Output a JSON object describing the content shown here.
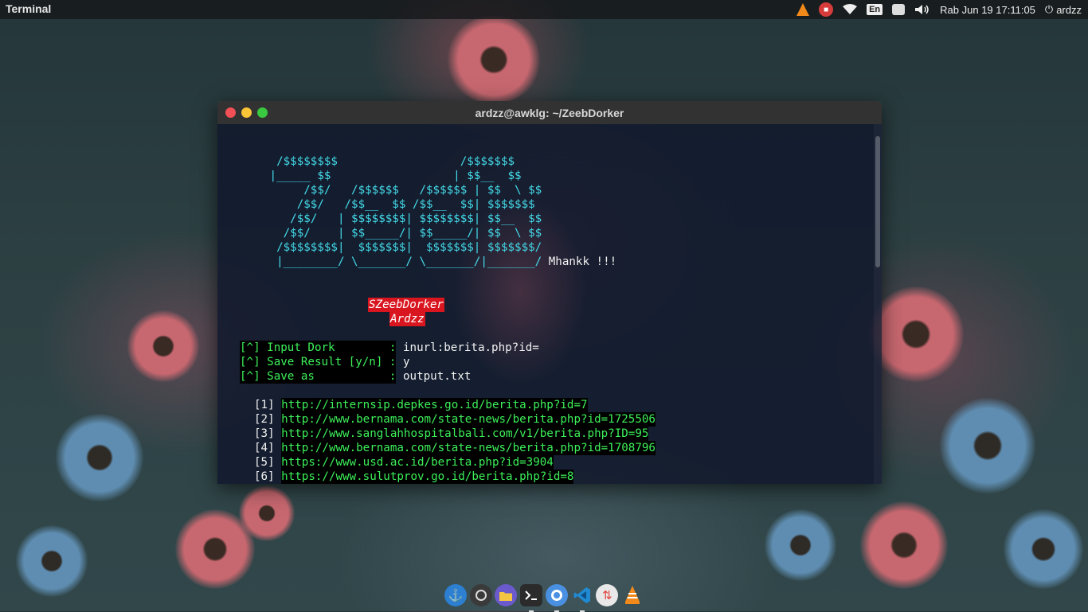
{
  "topbar": {
    "app_title": "Terminal",
    "datetime": "Rab Jun 19 17:11:05",
    "user": "ardzz",
    "keyboard_layout": "En"
  },
  "window": {
    "title": "ardzz@awklg: ~/ZeebDorker"
  },
  "terminal": {
    "ascii_lines": [
      "  /$$$$$$$$                  /$$$$$$$ ",
      " |_____ $$                  | $$__  $$",
      "      /$$/   /$$$$$$   /$$$$$$ | $$  \\ $$",
      "     /$$/   /$$__  $$ /$$__  $$| $$$$$$$ ",
      "    /$$/   | $$$$$$$$| $$$$$$$$| $$__  $$",
      "   /$$/    | $$_____/| $$_____/| $$  \\ $$",
      "  /$$$$$$$$|  $$$$$$$|  $$$$$$$| $$$$$$$/",
      "  |________/ \\_______/ \\_______/|_______/ "
    ],
    "ascii_tag": "Mhankk !!!",
    "credit_tool": "SZeebDorker",
    "credit_author": "Ardzz",
    "prompts": [
      {
        "label": "[^] Input Dork        :",
        "value": " inurl:berita.php?id="
      },
      {
        "label": "[^] Save Result [y/n] :",
        "value": " y"
      },
      {
        "label": "[^] Save as           :",
        "value": " output.txt"
      }
    ],
    "results": [
      {
        "num": "[1] ",
        "url": "http://internsip.depkes.go.id/berita.php?id=7"
      },
      {
        "num": "[2] ",
        "url": "http://www.bernama.com/state-news/berita.php?id=1725506"
      },
      {
        "num": "[3] ",
        "url": "http://www.sanglahhospitalbali.com/v1/berita.php?ID=95"
      },
      {
        "num": "[4] ",
        "url": "http://www.bernama.com/state-news/berita.php?id=1708796"
      },
      {
        "num": "[5] ",
        "url": "https://www.usd.ac.id/berita.php?id=3904"
      },
      {
        "num": "[6] ",
        "url": "https://www.sulutprov.go.id/berita.php?id=8"
      }
    ]
  },
  "dock": {
    "items": [
      "anchor-icon",
      "circle-icon",
      "folder-icon",
      "terminal-icon",
      "browser-icon",
      "vscode-icon",
      "transfer-icon",
      "vlc-icon"
    ]
  },
  "colors": {
    "ascii": "#44dcea",
    "prompt_green": "#3df05a",
    "credit_red": "#d9161f"
  }
}
